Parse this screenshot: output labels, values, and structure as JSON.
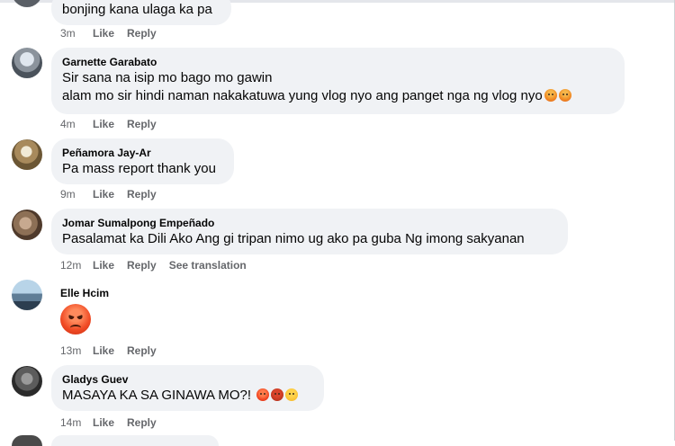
{
  "comments": [
    {
      "author": "",
      "text": "bonjing kana ulaga ka pa",
      "time": "3m",
      "like": "Like",
      "reply": "Reply"
    },
    {
      "author": "Garnette Garabato",
      "line1": "Sir sana na isip mo bago mo gawin",
      "line2": "alam mo sir hindi naman nakakatuwa yung vlog nyo ang panget nga ng vlog nyo",
      "reactions": [
        "angry-face-emoji",
        "angry-face-emoji"
      ],
      "time": "4m",
      "like": "Like",
      "reply": "Reply"
    },
    {
      "author": "Peñamora Jay-Ar",
      "text": "Pa mass report thank you",
      "time": "9m",
      "like": "Like",
      "reply": "Reply"
    },
    {
      "author": "Jomar Sumalpong Empeñado",
      "text": "Pasalamat ka Dili Ako Ang gi tripan nimo ug ako pa guba Ng imong sakyanan",
      "time": "12m",
      "like": "Like",
      "reply": "Reply",
      "see_translation": "See translation"
    },
    {
      "author": "Elle Hcim",
      "reaction": "angry-face-emoji",
      "time": "13m",
      "like": "Like",
      "reply": "Reply"
    },
    {
      "author": "Gladys Guev",
      "text": "MASAYA KA SA GINAWA MO?!",
      "reactions": [
        "angry-face-emoji",
        "cursing-face-emoji",
        "steam-face-emoji"
      ],
      "time": "14m",
      "like": "Like",
      "reply": "Reply"
    }
  ],
  "colors": {
    "bubble": "#f0f2f5",
    "meta_text": "#65676b",
    "text": "#050505"
  }
}
